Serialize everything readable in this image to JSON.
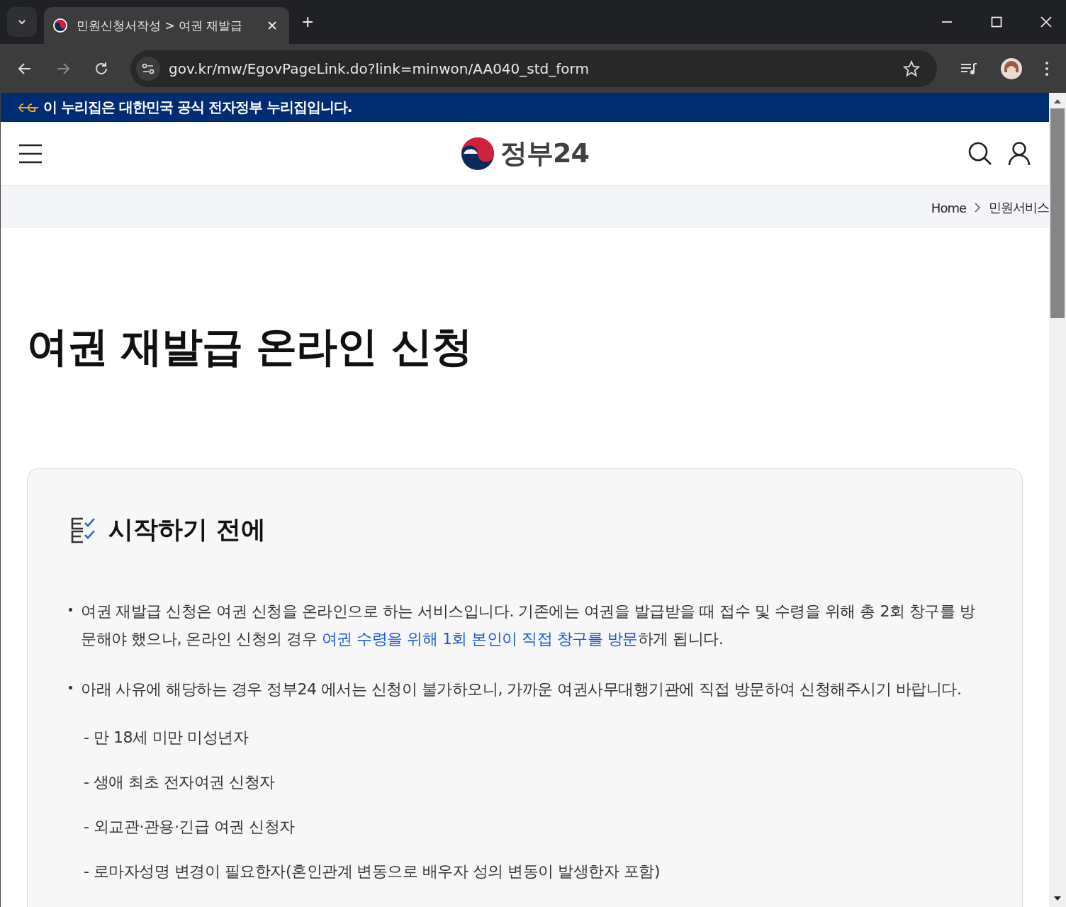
{
  "browser": {
    "tab_title": "민원신청서작성 > 여권 재발급",
    "new_tab": "+",
    "url": "gov.kr/mw/EgovPageLink.do?link=minwon/AA040_std_form"
  },
  "banner": {
    "text": "이 누리집은 대한민국 공식 전자정부 누리집입니다."
  },
  "header": {
    "logo_text": "정부24"
  },
  "breadcrumb": [
    "Home",
    "민원서비스"
  ],
  "page_title": "여권 재발급 온라인 신청",
  "section": {
    "title": "시작하기 전에",
    "bullets": [
      [
        {
          "kind": "text",
          "text": "여권 재발급 신청은 여권 신청을 온라인으로 하는 서비스입니다. 기존에는 여권을 발급받을 때 접수 및 수령을 위해 총 2회 창구를 방문해야 했으나, 온라인 신청의 경우 "
        },
        {
          "kind": "link",
          "text": "여권 수령을 위해 1회 본인이 직접 창구를 방문"
        },
        {
          "kind": "text",
          "text": "하게 됩니다."
        }
      ],
      [
        {
          "kind": "text",
          "text": "아래 사유에 해당하는 경우 정부24 에서는 신청이 불가하오니, 가까운 여권사무대행기관에 직접 방문하여 신청해주시기 바랍니다."
        }
      ]
    ],
    "sub_items": [
      "- 만 18세 미만 미성년자",
      "- 생애 최초 전자여권 신청자",
      "- 외교관·관용·긴급 여권 신청자",
      "- 로마자성명 변경이 필요한자(혼인관계 변동으로 배우자 성의 변동이 발생한자 포함)"
    ]
  }
}
